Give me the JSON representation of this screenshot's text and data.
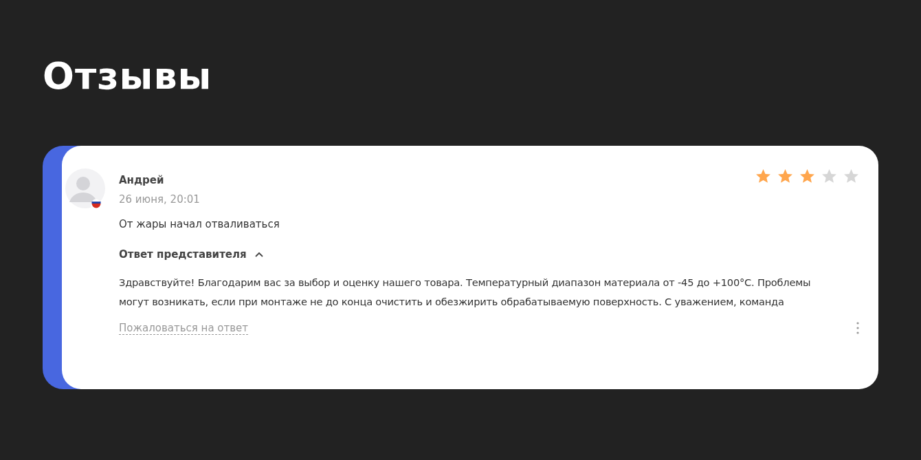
{
  "title": "Отзывы",
  "review": {
    "author": "Андрей",
    "date": "26 июня, 20:01",
    "stars": 3,
    "text": "От жары начал отваливаться",
    "reply": {
      "label": "Ответ представителя",
      "expanded": true,
      "text": "Здравствуйте! Благодарим вас за выбор и оценку нашего товара. Температурный диапазон материала от -45 до +100°C. Проблемы могут возникать, если при монтаже не до конца очистить и обезжирить обрабатываемую поверхность. С уважением, команда"
    },
    "complaint_link": "Пожаловаться на ответ"
  }
}
